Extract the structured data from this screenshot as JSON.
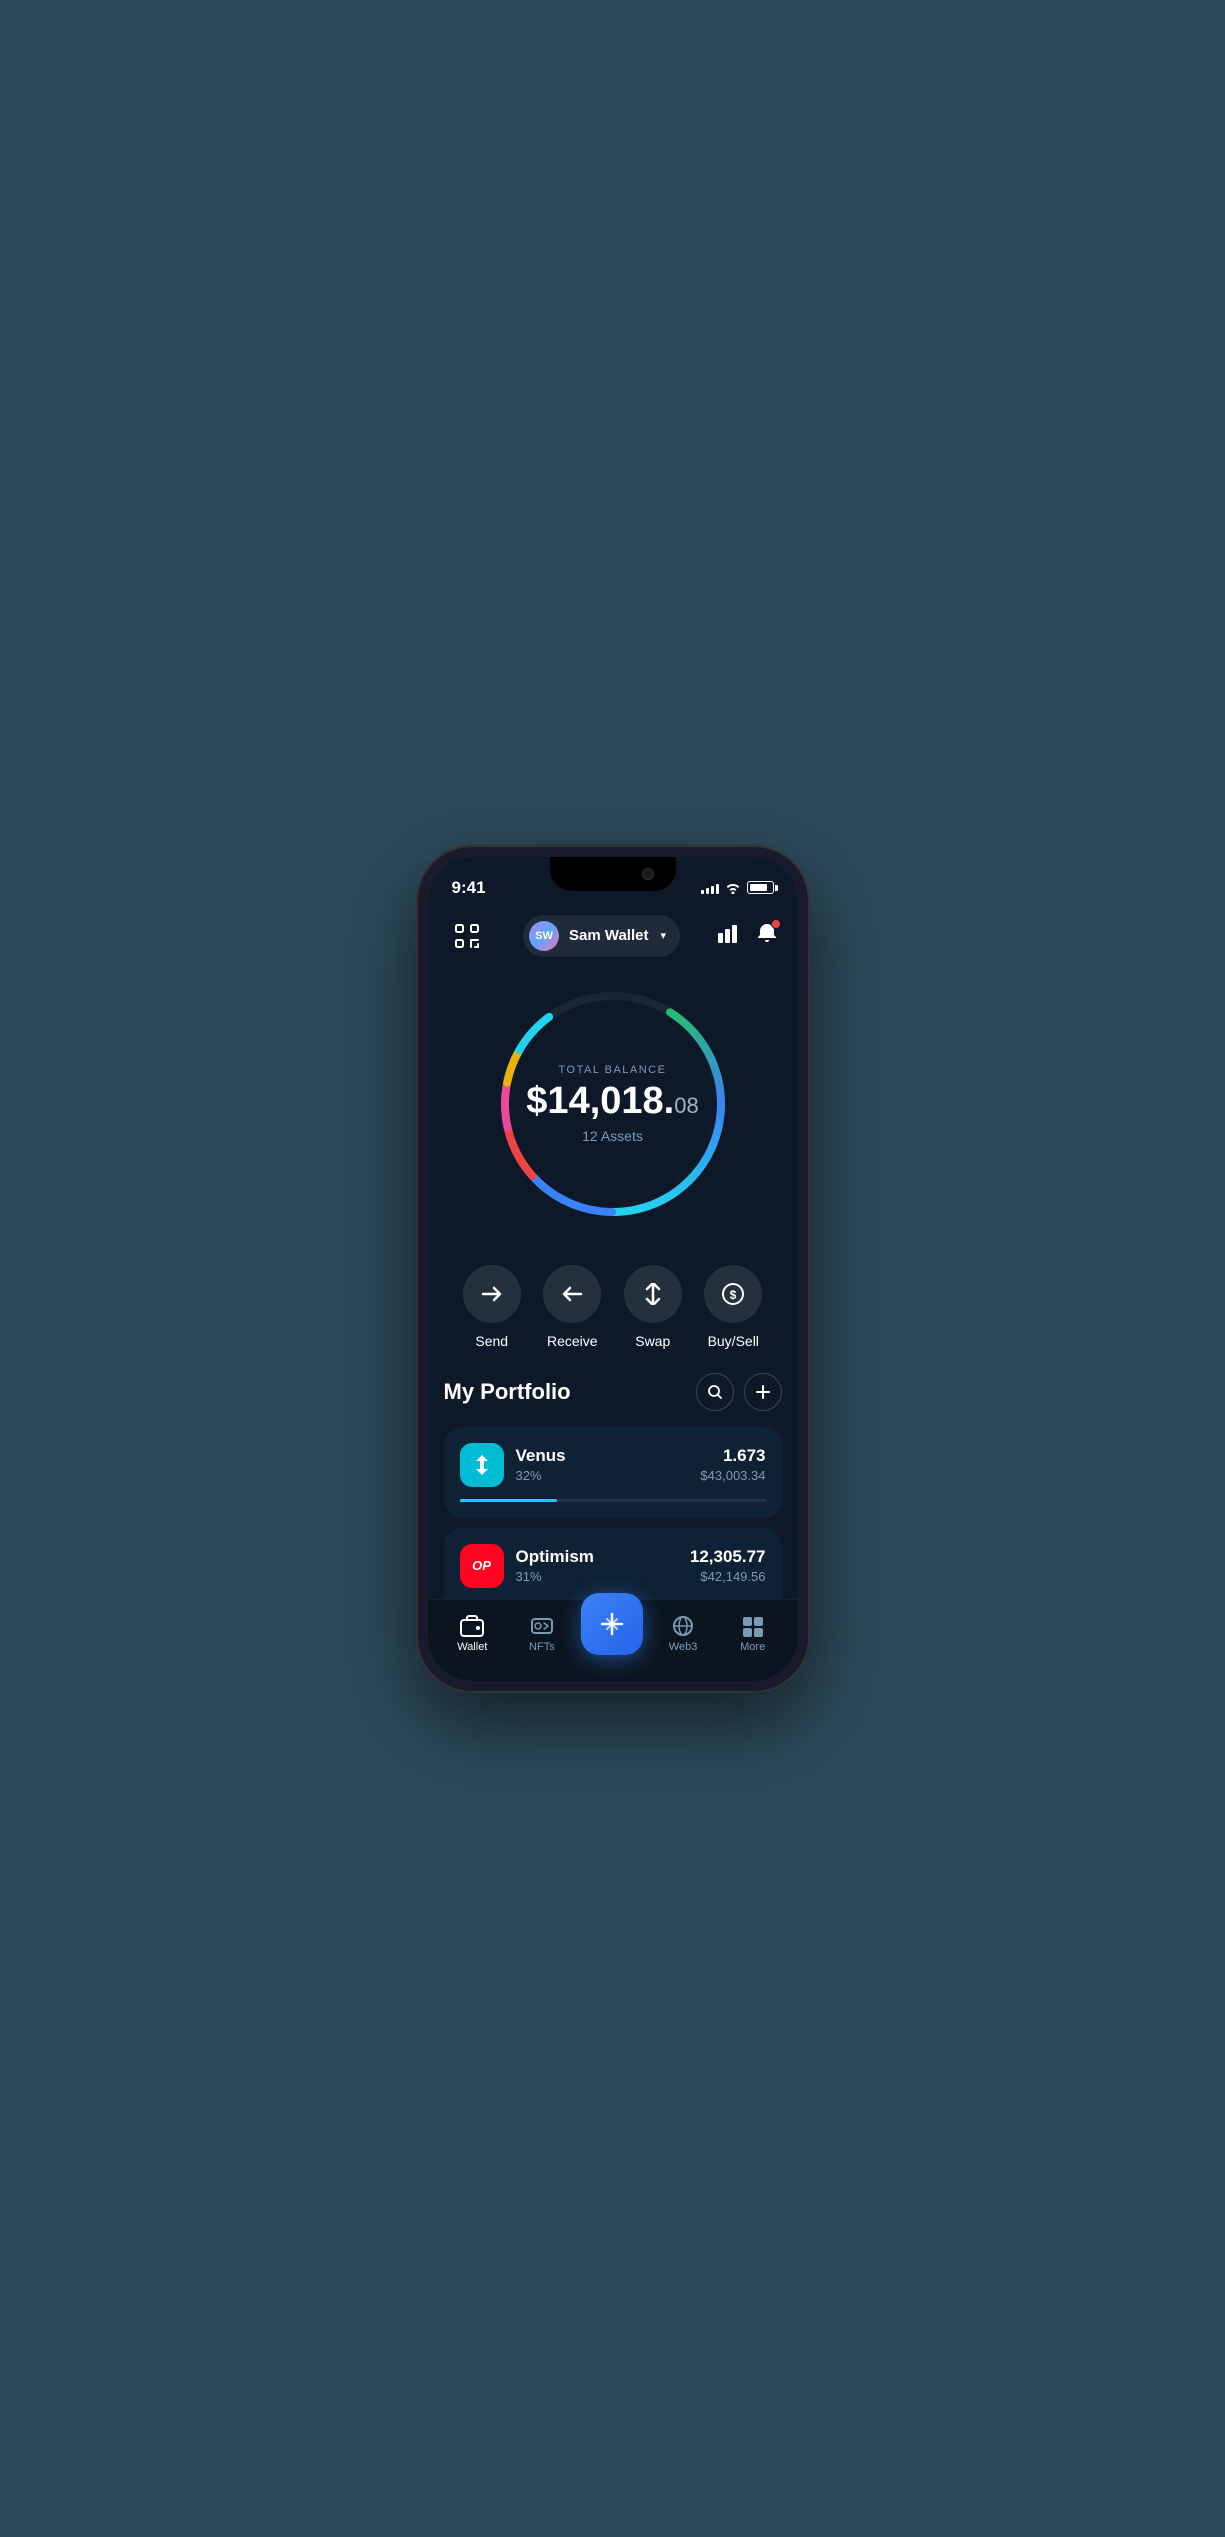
{
  "status": {
    "time": "9:41",
    "signal_bars": [
      3,
      5,
      7,
      9,
      11
    ],
    "battery_percent": 85
  },
  "header": {
    "scan_label": "scan",
    "wallet_initials": "SW",
    "wallet_name": "Sam Wallet",
    "chevron": "▾",
    "chart_icon": "📊",
    "notification_badge": true
  },
  "balance": {
    "label": "TOTAL BALANCE",
    "integer": "$14,018.",
    "cents": "08",
    "assets_label": "12 Assets"
  },
  "actions": [
    {
      "id": "send",
      "label": "Send",
      "icon": "→"
    },
    {
      "id": "receive",
      "label": "Receive",
      "icon": "←"
    },
    {
      "id": "swap",
      "label": "Swap",
      "icon": "⇅"
    },
    {
      "id": "buysell",
      "label": "Buy/Sell",
      "icon": "💲"
    }
  ],
  "portfolio": {
    "title": "My Portfolio",
    "search_label": "🔍",
    "add_label": "+",
    "assets": [
      {
        "id": "venus",
        "name": "Venus",
        "percent": "32%",
        "amount": "1.673",
        "value": "$43,003.34",
        "progress": 32,
        "icon_text": "✦",
        "icon_bg": "#00bcd4"
      },
      {
        "id": "optimism",
        "name": "Optimism",
        "percent": "31%",
        "amount": "12,305.77",
        "value": "$42,149.56",
        "progress": 31,
        "icon_text": "OP",
        "icon_bg": "#ff0420"
      }
    ]
  },
  "nav": {
    "items": [
      {
        "id": "wallet",
        "label": "Wallet",
        "active": true
      },
      {
        "id": "nfts",
        "label": "NFTs",
        "active": false
      },
      {
        "id": "center",
        "label": "",
        "is_center": true
      },
      {
        "id": "web3",
        "label": "Web3",
        "active": false
      },
      {
        "id": "more",
        "label": "More",
        "active": false
      }
    ]
  },
  "colors": {
    "bg_primary": "#0d1928",
    "bg_card": "#0f2235",
    "accent_blue": "#3b82f6",
    "text_primary": "#ffffff",
    "text_secondary": "#7a9bb5"
  }
}
